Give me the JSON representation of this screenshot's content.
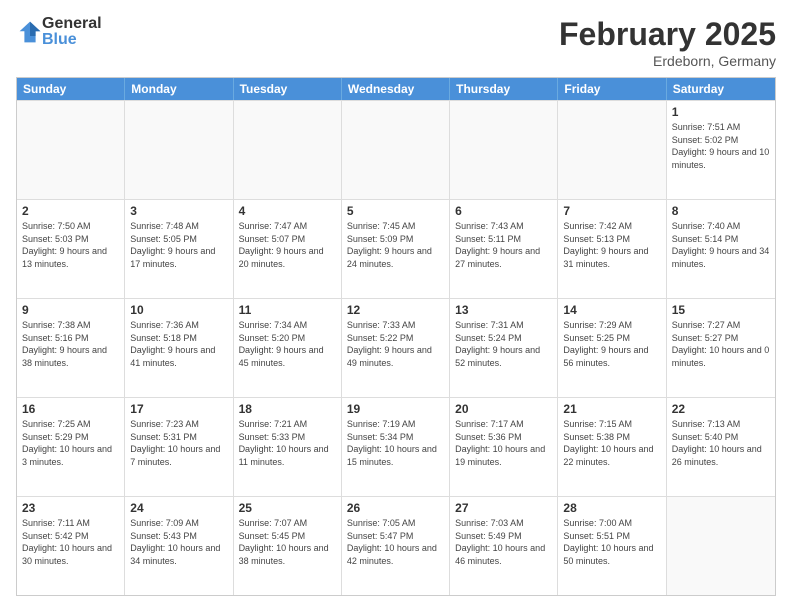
{
  "logo": {
    "general": "General",
    "blue": "Blue"
  },
  "title": "February 2025",
  "location": "Erdeborn, Germany",
  "days": [
    "Sunday",
    "Monday",
    "Tuesday",
    "Wednesday",
    "Thursday",
    "Friday",
    "Saturday"
  ],
  "weeks": [
    [
      {
        "day": "",
        "text": ""
      },
      {
        "day": "",
        "text": ""
      },
      {
        "day": "",
        "text": ""
      },
      {
        "day": "",
        "text": ""
      },
      {
        "day": "",
        "text": ""
      },
      {
        "day": "",
        "text": ""
      },
      {
        "day": "1",
        "text": "Sunrise: 7:51 AM\nSunset: 5:02 PM\nDaylight: 9 hours and 10 minutes."
      }
    ],
    [
      {
        "day": "2",
        "text": "Sunrise: 7:50 AM\nSunset: 5:03 PM\nDaylight: 9 hours and 13 minutes."
      },
      {
        "day": "3",
        "text": "Sunrise: 7:48 AM\nSunset: 5:05 PM\nDaylight: 9 hours and 17 minutes."
      },
      {
        "day": "4",
        "text": "Sunrise: 7:47 AM\nSunset: 5:07 PM\nDaylight: 9 hours and 20 minutes."
      },
      {
        "day": "5",
        "text": "Sunrise: 7:45 AM\nSunset: 5:09 PM\nDaylight: 9 hours and 24 minutes."
      },
      {
        "day": "6",
        "text": "Sunrise: 7:43 AM\nSunset: 5:11 PM\nDaylight: 9 hours and 27 minutes."
      },
      {
        "day": "7",
        "text": "Sunrise: 7:42 AM\nSunset: 5:13 PM\nDaylight: 9 hours and 31 minutes."
      },
      {
        "day": "8",
        "text": "Sunrise: 7:40 AM\nSunset: 5:14 PM\nDaylight: 9 hours and 34 minutes."
      }
    ],
    [
      {
        "day": "9",
        "text": "Sunrise: 7:38 AM\nSunset: 5:16 PM\nDaylight: 9 hours and 38 minutes."
      },
      {
        "day": "10",
        "text": "Sunrise: 7:36 AM\nSunset: 5:18 PM\nDaylight: 9 hours and 41 minutes."
      },
      {
        "day": "11",
        "text": "Sunrise: 7:34 AM\nSunset: 5:20 PM\nDaylight: 9 hours and 45 minutes."
      },
      {
        "day": "12",
        "text": "Sunrise: 7:33 AM\nSunset: 5:22 PM\nDaylight: 9 hours and 49 minutes."
      },
      {
        "day": "13",
        "text": "Sunrise: 7:31 AM\nSunset: 5:24 PM\nDaylight: 9 hours and 52 minutes."
      },
      {
        "day": "14",
        "text": "Sunrise: 7:29 AM\nSunset: 5:25 PM\nDaylight: 9 hours and 56 minutes."
      },
      {
        "day": "15",
        "text": "Sunrise: 7:27 AM\nSunset: 5:27 PM\nDaylight: 10 hours and 0 minutes."
      }
    ],
    [
      {
        "day": "16",
        "text": "Sunrise: 7:25 AM\nSunset: 5:29 PM\nDaylight: 10 hours and 3 minutes."
      },
      {
        "day": "17",
        "text": "Sunrise: 7:23 AM\nSunset: 5:31 PM\nDaylight: 10 hours and 7 minutes."
      },
      {
        "day": "18",
        "text": "Sunrise: 7:21 AM\nSunset: 5:33 PM\nDaylight: 10 hours and 11 minutes."
      },
      {
        "day": "19",
        "text": "Sunrise: 7:19 AM\nSunset: 5:34 PM\nDaylight: 10 hours and 15 minutes."
      },
      {
        "day": "20",
        "text": "Sunrise: 7:17 AM\nSunset: 5:36 PM\nDaylight: 10 hours and 19 minutes."
      },
      {
        "day": "21",
        "text": "Sunrise: 7:15 AM\nSunset: 5:38 PM\nDaylight: 10 hours and 22 minutes."
      },
      {
        "day": "22",
        "text": "Sunrise: 7:13 AM\nSunset: 5:40 PM\nDaylight: 10 hours and 26 minutes."
      }
    ],
    [
      {
        "day": "23",
        "text": "Sunrise: 7:11 AM\nSunset: 5:42 PM\nDaylight: 10 hours and 30 minutes."
      },
      {
        "day": "24",
        "text": "Sunrise: 7:09 AM\nSunset: 5:43 PM\nDaylight: 10 hours and 34 minutes."
      },
      {
        "day": "25",
        "text": "Sunrise: 7:07 AM\nSunset: 5:45 PM\nDaylight: 10 hours and 38 minutes."
      },
      {
        "day": "26",
        "text": "Sunrise: 7:05 AM\nSunset: 5:47 PM\nDaylight: 10 hours and 42 minutes."
      },
      {
        "day": "27",
        "text": "Sunrise: 7:03 AM\nSunset: 5:49 PM\nDaylight: 10 hours and 46 minutes."
      },
      {
        "day": "28",
        "text": "Sunrise: 7:00 AM\nSunset: 5:51 PM\nDaylight: 10 hours and 50 minutes."
      },
      {
        "day": "",
        "text": ""
      }
    ]
  ]
}
